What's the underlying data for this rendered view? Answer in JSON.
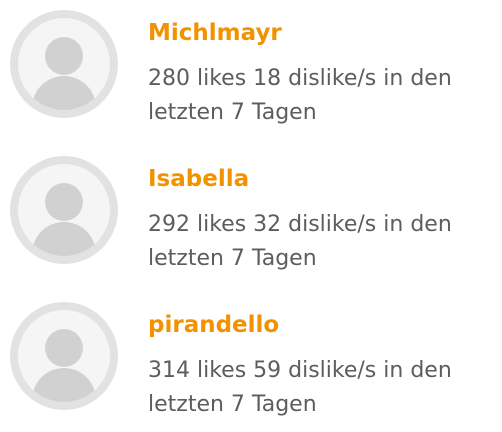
{
  "users": [
    {
      "name": "Michlmayr",
      "avatar_icon": "user-avatar-placeholder-icon",
      "stats_line1": "280 likes 18 dislike/s in den",
      "stats_line2": "letzten 7 Tagen"
    },
    {
      "name": "Isabella",
      "avatar_icon": "user-avatar-placeholder-icon",
      "stats_line1": "292 likes 32 dislike/s in den",
      "stats_line2": "letzten 7 Tagen"
    },
    {
      "name": "pirandello",
      "avatar_icon": "user-avatar-placeholder-icon",
      "stats_line1": "314 likes 59 dislike/s in den",
      "stats_line2": "letzten 7 Tagen"
    }
  ],
  "colors": {
    "name_accent": "#f39200",
    "text": "#5d5d5d",
    "avatar_ring": "#e2e2e2",
    "avatar_fill": "#d1d1d1"
  }
}
